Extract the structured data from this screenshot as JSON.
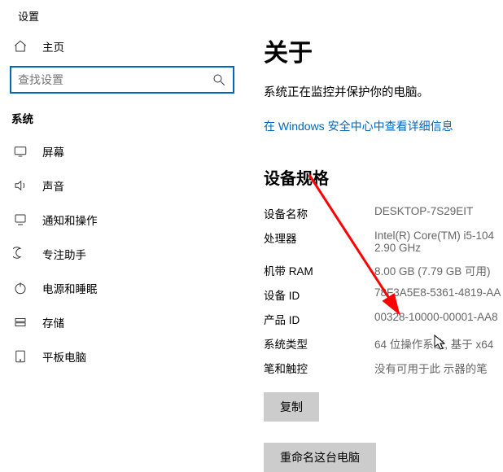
{
  "sidebar": {
    "appTitle": "设置",
    "home": "主页",
    "searchPlaceholder": "查找设置",
    "sectionLabel": "系统",
    "items": [
      {
        "label": "屏幕"
      },
      {
        "label": "声音"
      },
      {
        "label": "通知和操作"
      },
      {
        "label": "专注助手"
      },
      {
        "label": "电源和睡眠"
      },
      {
        "label": "存储"
      },
      {
        "label": "平板电脑"
      }
    ]
  },
  "main": {
    "title": "关于",
    "protectText": "系统正在监控并保护你的电脑。",
    "securityLink": "在 Windows 安全中心中查看详细信息",
    "specsHeading": "设备规格",
    "specs": [
      {
        "label": "设备名称",
        "value": "DESKTOP-7S29EIT"
      },
      {
        "label": "处理器",
        "value": "Intel(R) Core(TM) i5-104\n2.90 GHz"
      },
      {
        "label": "机带 RAM",
        "value": "8.00 GB (7.79 GB 可用)"
      },
      {
        "label": "设备 ID",
        "value": "78F3A5E8-5361-4819-AA"
      },
      {
        "label": "产品 ID",
        "value": "00328-10000-00001-AA8"
      },
      {
        "label": "系统类型",
        "value": "64 位操作系统, 基于 x64"
      },
      {
        "label": "笔和触控",
        "value": "没有可用于此  示器的笔"
      }
    ],
    "copyBtn": "复制",
    "renameBtn": "重命名这台电脑"
  }
}
